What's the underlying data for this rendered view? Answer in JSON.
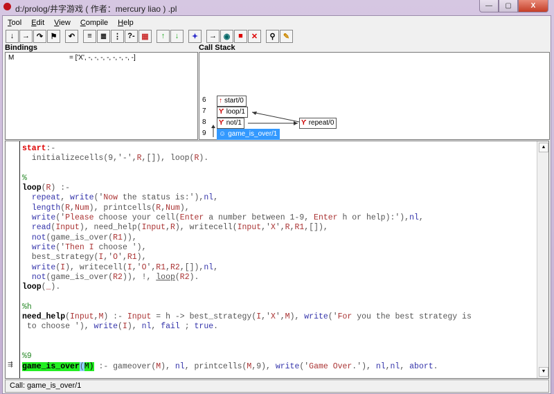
{
  "window": {
    "title": "d:/prolog/井字游戏 ( 作者：mercury liao ) .pl",
    "controls": {
      "minimize": "—",
      "maximize": "▢",
      "close": "X"
    }
  },
  "menubar": {
    "items": [
      {
        "label": "Tool",
        "accel": "T"
      },
      {
        "label": "Edit",
        "accel": "E"
      },
      {
        "label": "View",
        "accel": "V"
      },
      {
        "label": "Compile",
        "accel": "C"
      },
      {
        "label": "Help",
        "accel": "H"
      }
    ]
  },
  "toolbar": {
    "buttons": [
      {
        "name": "creep",
        "glyph": "↓"
      },
      {
        "name": "skip",
        "glyph": "→"
      },
      {
        "name": "leap",
        "glyph": "↷"
      },
      {
        "name": "finish",
        "glyph": "⚑"
      },
      {
        "name": "retry",
        "glyph": "↶"
      },
      {
        "name": "step-in",
        "glyph": "≡"
      },
      {
        "name": "step-out",
        "glyph": "≣"
      },
      {
        "name": "step-over",
        "glyph": "⋮"
      },
      {
        "name": "query",
        "glyph": "?-"
      },
      {
        "name": "abort-frame",
        "glyph": "▦"
      },
      {
        "name": "up-stack",
        "glyph": "↑"
      },
      {
        "name": "down-stack",
        "glyph": "↓"
      },
      {
        "name": "spy",
        "glyph": "✦"
      },
      {
        "name": "break",
        "glyph": "→"
      },
      {
        "name": "detective",
        "glyph": "◉"
      },
      {
        "name": "stop",
        "glyph": "■"
      },
      {
        "name": "nodebug",
        "glyph": "✕"
      },
      {
        "name": "zoom",
        "glyph": "⚲"
      },
      {
        "name": "edit",
        "glyph": "✎"
      }
    ]
  },
  "bindings": {
    "label": "Bindings",
    "rows": [
      {
        "var": "M",
        "value": "= ['X', -, -, -, -, -, -, -, -]"
      }
    ]
  },
  "callstack": {
    "label": "Call Stack",
    "frames": [
      {
        "num": "6",
        "name": "start/0",
        "icon": "↑"
      },
      {
        "num": "7",
        "name": "loop/1",
        "icon": "Ƴ"
      },
      {
        "num": "8",
        "name": "not/1",
        "icon": "Ƴ"
      },
      {
        "num": "9",
        "name": "game_is_over/1",
        "icon": "☺",
        "selected": true
      }
    ],
    "side_frame": {
      "name": "repeat/0",
      "icon": "Ƴ"
    }
  },
  "editor": {
    "lines": [
      "start:-",
      "  initializecells(9,'-',R,[]), loop(R).",
      "",
      "%",
      "loop(R) :-",
      "  repeat, write('Now the status is:'),nl,",
      "  length(R,Num), printcells(R,Num),",
      "  write('Please choose your cell(Enter a number between 1-9, Enter h or help):'),nl,",
      "  read(Input), need_help(Input,R), writecell(Input,'X',R,R1,[]),",
      "  not(game_is_over(R1)),",
      "  write('Then I choose '),",
      "  best_strategy(I,'O',R1),",
      "  write(I), writecell(I,'O',R1,R2,[]),nl,",
      "  not(game_is_over(R2)), !, loop(R2).",
      "loop(_).",
      "",
      "%h",
      "need_help(Input,M) :- Input = h -> best_strategy(I,'X',M), write('For you the best strategy is",
      " to choose '), write(I), nl, fail ; true.",
      "",
      "",
      "%9",
      "game_is_over(M) :- gameover(M), nl, printcells(M,9), write('Game Over.'), nl,nl, abort."
    ]
  },
  "status": {
    "text": "Call: game_is_over/1"
  }
}
